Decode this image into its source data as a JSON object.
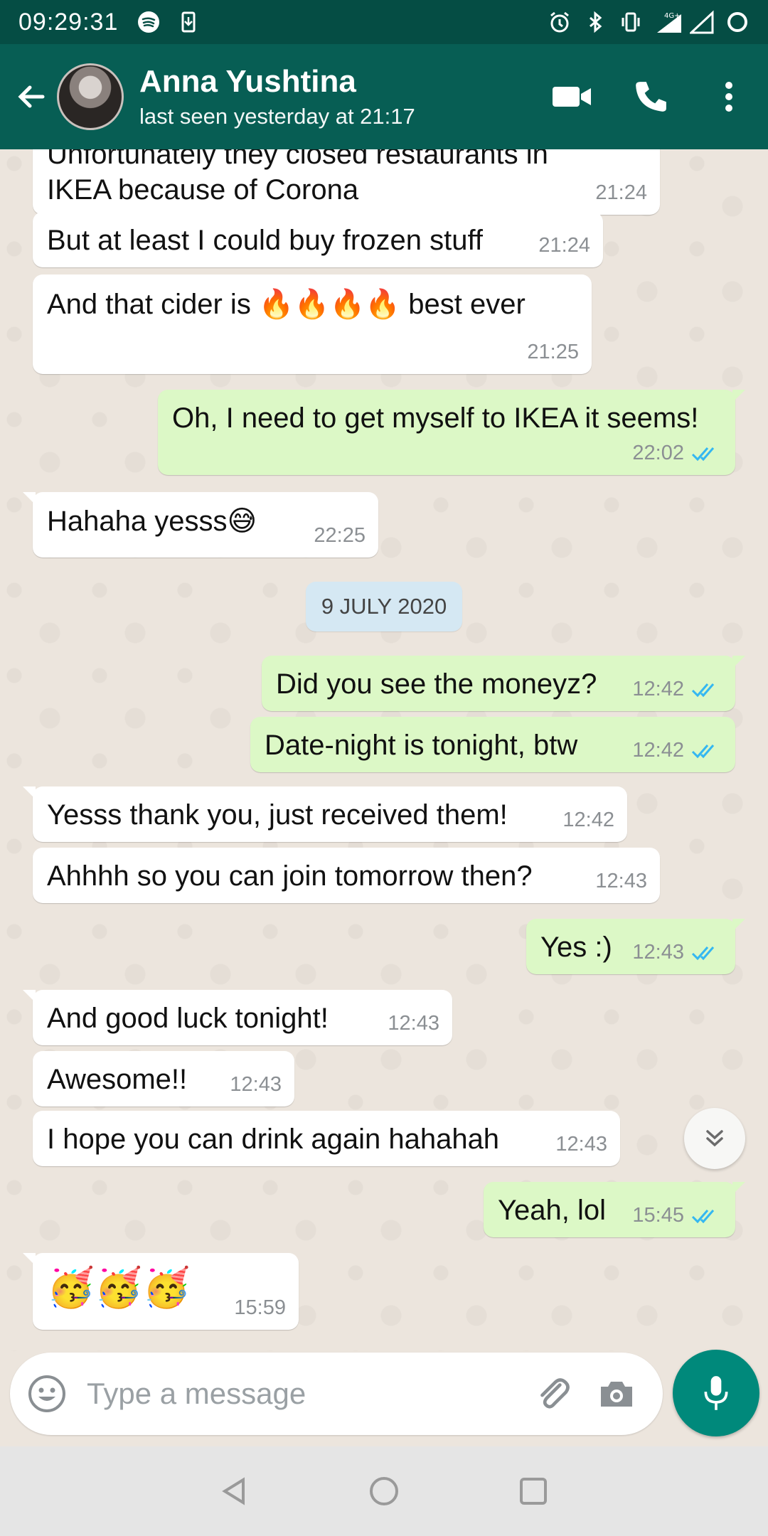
{
  "status_bar": {
    "time": "09:29:31",
    "network": "4G+"
  },
  "header": {
    "contact_name": "Anna Yushtina",
    "last_seen": "last seen yesterday at 21:17"
  },
  "messages": [
    {
      "dir": "in",
      "text": "Unfortunately they closed restaurants in IKEA because of Corona",
      "time": "21:24"
    },
    {
      "dir": "in",
      "text": "But at least I could buy frozen stuff",
      "time": "21:24"
    },
    {
      "dir": "in",
      "text": "And that cider is 🔥🔥🔥🔥 best ever",
      "time": "21:25"
    },
    {
      "dir": "out",
      "text": "Oh, I need to get myself to IKEA it seems!",
      "time": "22:02"
    },
    {
      "dir": "in",
      "text": "Hahaha yesss😅",
      "time": "22:25"
    },
    {
      "dir": "out",
      "text": "Did you see the moneyz?",
      "time": "12:42"
    },
    {
      "dir": "out",
      "text": "Date-night is tonight, btw",
      "time": "12:42"
    },
    {
      "dir": "in",
      "text": "Yesss thank you, just received them!",
      "time": "12:42"
    },
    {
      "dir": "in",
      "text": "Ahhhh so you can join tomorrow then?",
      "time": "12:43"
    },
    {
      "dir": "out",
      "text": "Yes :)",
      "time": "12:43"
    },
    {
      "dir": "in",
      "text": "And good luck tonight!",
      "time": "12:43"
    },
    {
      "dir": "in",
      "text": "Awesome!!",
      "time": "12:43"
    },
    {
      "dir": "in",
      "text": "I hope you can drink again hahahah",
      "time": "12:43"
    },
    {
      "dir": "out",
      "text": "Yeah, lol",
      "time": "15:45"
    },
    {
      "dir": "in",
      "text": "🥳🥳🥳",
      "time": "15:59"
    }
  ],
  "date_divider": "9 JULY 2020",
  "composer": {
    "placeholder": "Type a message"
  },
  "colors": {
    "header": "#075e54",
    "status_bar": "#054d44",
    "outgoing": "#dcf8c6",
    "incoming": "#ffffff",
    "accent": "#00897b",
    "ticks": "#34b7f1"
  },
  "icons": [
    "back-arrow-icon",
    "video-call-icon",
    "phone-icon",
    "more-vert-icon",
    "emoji-icon",
    "attach-icon",
    "camera-icon",
    "mic-icon",
    "scroll-down-icon",
    "nav-back-icon",
    "nav-home-icon",
    "nav-recents-icon"
  ]
}
